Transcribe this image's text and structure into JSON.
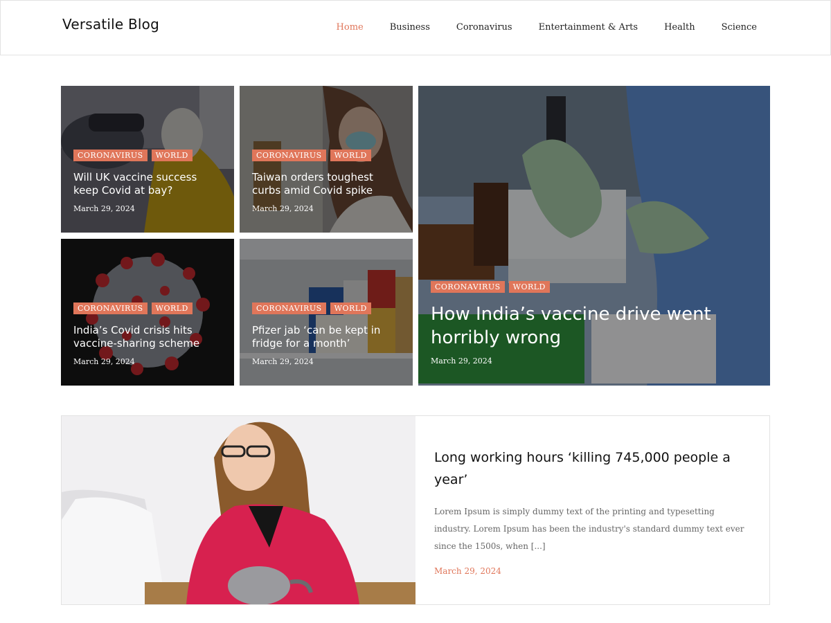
{
  "site": {
    "title": "Versatile Blog"
  },
  "nav": {
    "items": [
      {
        "label": "Home",
        "active": true
      },
      {
        "label": "Business"
      },
      {
        "label": "Coronavirus"
      },
      {
        "label": "Entertainment & Arts"
      },
      {
        "label": "Health"
      },
      {
        "label": "Science"
      }
    ]
  },
  "grid": {
    "cards": [
      {
        "tags": [
          "CORONAVIRUS",
          "WORLD"
        ],
        "title": "Will UK vaccine success keep Covid at bay?",
        "date": "March 29, 2024"
      },
      {
        "tags": [
          "CORONAVIRUS",
          "WORLD"
        ],
        "title": "Taiwan orders toughest curbs amid Covid spike",
        "date": "March 29, 2024"
      },
      {
        "tags": [
          "CORONAVIRUS",
          "WORLD"
        ],
        "title": "India’s Covid crisis hits vaccine-sharing scheme",
        "date": "March 29, 2024"
      },
      {
        "tags": [
          "CORONAVIRUS",
          "WORLD"
        ],
        "title": "Pfizer jab ‘can be kept in fridge for a month’",
        "date": "March 29, 2024"
      },
      {
        "tags": [
          "CORONAVIRUS",
          "WORLD"
        ],
        "title": "How India’s vaccine drive went horribly wrong",
        "date": "March 29, 2024"
      }
    ]
  },
  "feature": {
    "title": "Long working hours ‘killing 745,000 people a year’",
    "excerpt": "Lorem Ipsum is simply dummy text of the printing and typesetting industry. Lorem Ipsum has been the industry's standard dummy text ever since the 1500s, when [...]",
    "date": "March 29, 2024"
  },
  "colors": {
    "accent": "#e0765a"
  }
}
